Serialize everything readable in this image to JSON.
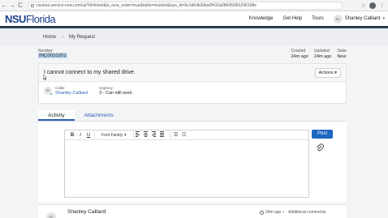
{
  "browser": {
    "url": "nsutest.service-now.com/sp?id=ticket&is_new_order=true&table=incident&sys_id=6c1d6db3dba0f410a0864509f1296198e",
    "back": "←",
    "forward": "→",
    "reload": "C"
  },
  "header": {
    "logo_main": "NSU",
    "logo_sub": "Florida",
    "links": [
      "Knowledge",
      "Get Help",
      "Tours"
    ],
    "user_initials": "SC",
    "user_name": "Shanley Calliard"
  },
  "breadcrumb": [
    "Home",
    "My Request"
  ],
  "ticket": {
    "number_label": "Number",
    "number": "INC0010201",
    "created_label": "Created",
    "created": "24m ago",
    "updated_label": "Updated",
    "updated": "24m ago",
    "state_label": "State",
    "state": "New",
    "short_description": "I cannot connect to my shared drive.",
    "actions_label": "Actions",
    "caller_label": "Caller",
    "caller_initials": "SC",
    "caller_name": "Shanley Calliard",
    "urgency_label": "Urgency",
    "urgency": "3 - Can still work"
  },
  "tabs": [
    "Activity",
    "Attachments"
  ],
  "editor": {
    "font_family_label": "Font Family",
    "post_label": "Post"
  },
  "comment": {
    "author_initials": "SC",
    "author": "Shanley Calliard",
    "time": "24m ago",
    "kind": "Additional comments"
  }
}
